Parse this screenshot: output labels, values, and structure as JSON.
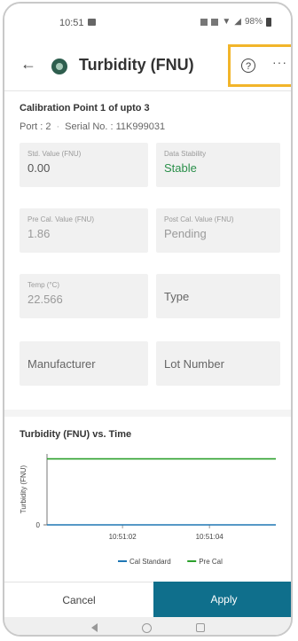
{
  "status": {
    "time": "10:51",
    "battery": "98%"
  },
  "appbar": {
    "back_label": "←",
    "title": "Turbidity (FNU)",
    "help_label": "?",
    "more_label": "···"
  },
  "calibration": {
    "title": "Calibration Point 1 of upto 3",
    "port": "Port : 2",
    "serial": "Serial No. : 11K999031"
  },
  "fields": {
    "std_value": {
      "label": "Std. Value (FNU)",
      "value": "0.00"
    },
    "data_stability": {
      "label": "Data Stability",
      "value": "Stable"
    },
    "pre_cal": {
      "label": "Pre Cal. Value (FNU)",
      "value": "1.86"
    },
    "post_cal": {
      "label": "Post Cal. Value (FNU)",
      "value": "Pending"
    },
    "temp": {
      "label": "Temp (°C)",
      "value": "22.566"
    },
    "type": {
      "placeholder": "Type"
    },
    "manufacturer": {
      "placeholder": "Manufacturer"
    },
    "lot_number": {
      "placeholder": "Lot Number"
    }
  },
  "chart_data": {
    "type": "line",
    "title": "Turbidity (FNU) vs. Time",
    "ylabel": "Turbidity (FNU)",
    "xlabel": "",
    "x_ticks": [
      "10:51:02",
      "10:51:04"
    ],
    "y_ticks": [
      "0"
    ],
    "series": [
      {
        "name": "Cal Standard",
        "color": "#1f77b4",
        "values": [
          0.0,
          0.0
        ]
      },
      {
        "name": "Pre Cal",
        "color": "#2ca02c",
        "values": [
          1.86,
          1.86
        ]
      }
    ],
    "legend": "bottom",
    "grid": false
  },
  "actions": {
    "cancel": "Cancel",
    "apply": "Apply"
  },
  "colors": {
    "accent": "#0f6f8c",
    "highlight": "#f2b52a",
    "stable": "#2a8f4a"
  }
}
